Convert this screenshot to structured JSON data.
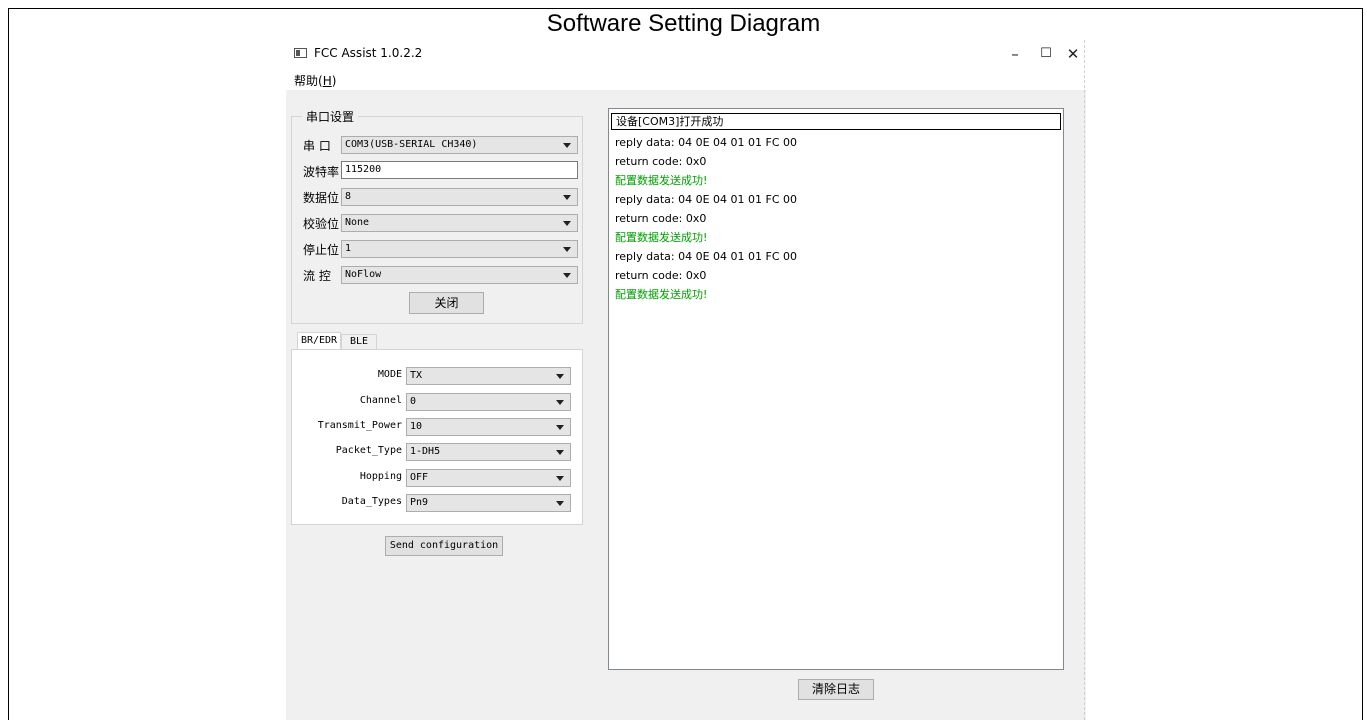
{
  "caption": "Software Setting Diagram",
  "window": {
    "title": "FCC Assist 1.0.2.2",
    "minimize_glyph": "–",
    "maximize_glyph": "☐",
    "close_glyph": "✕"
  },
  "menu": {
    "help_label": "帮助(",
    "help_key": "H",
    "help_close": ")"
  },
  "serial": {
    "group_title": "串口设置",
    "port_label": "串  口",
    "port_value": "COM3(USB-SERIAL CH340)",
    "baud_label": "波特率",
    "baud_value": "115200",
    "databits_label": "数据位",
    "databits_value": "8",
    "parity_label": "校验位",
    "parity_value": "None",
    "stopbits_label": "停止位",
    "stopbits_value": "1",
    "flow_label": "流  控",
    "flow_value": "NoFlow",
    "close_button": "关闭"
  },
  "tabs": [
    {
      "label": "BR/EDR",
      "active": true
    },
    {
      "label": "BLE",
      "active": false
    }
  ],
  "config": {
    "mode_label": "MODE",
    "mode_value": "TX",
    "channel_label": "Channel",
    "channel_value": "0",
    "power_label": "Transmit_Power",
    "power_value": "10",
    "packet_label": "Packet_Type",
    "packet_value": "1-DH5",
    "hopping_label": "Hopping",
    "hopping_value": "OFF",
    "datatypes_label": "Data_Types",
    "datatypes_value": "Pn9"
  },
  "send_button": "Send configuration",
  "log": [
    {
      "text": "设备[COM3]打开成功",
      "status": "normal"
    },
    {
      "text": "reply data: 04 0E 04 01 01 FC 00",
      "status": "normal"
    },
    {
      "text": "return code: 0x0",
      "status": "normal"
    },
    {
      "text": "配置数据发送成功!",
      "status": "success"
    },
    {
      "text": "reply data: 04 0E 04 01 01 FC 00",
      "status": "normal"
    },
    {
      "text": "return code: 0x0",
      "status": "normal"
    },
    {
      "text": "配置数据发送成功!",
      "status": "success"
    },
    {
      "text": "reply data: 04 0E 04 01 01 FC 00",
      "status": "normal"
    },
    {
      "text": "return code: 0x0",
      "status": "normal"
    },
    {
      "text": "配置数据发送成功!",
      "status": "success"
    }
  ],
  "clear_log_button": "清除日志",
  "colors": {
    "success_text": "#00a000",
    "window_bg": "#f0f0f0"
  }
}
